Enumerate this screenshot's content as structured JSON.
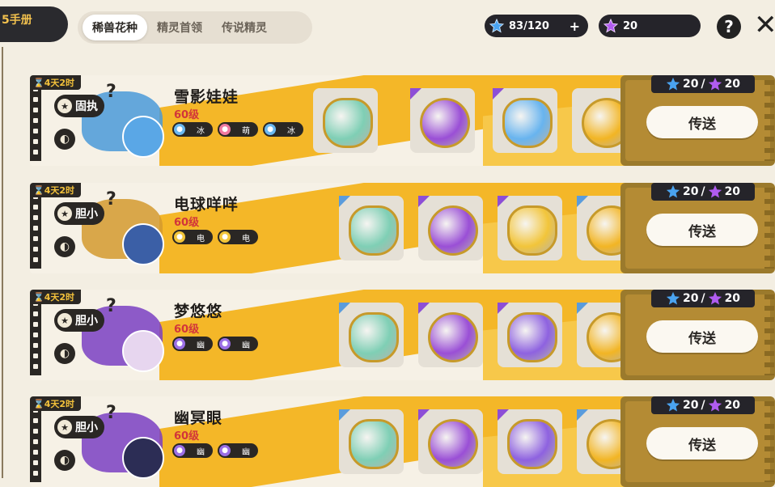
{
  "top_left_tab": {
    "label": "5手册"
  },
  "tabs": [
    {
      "label": "稀兽花种",
      "active": true
    },
    {
      "label": "精灵首领",
      "active": false
    },
    {
      "label": "传说精灵",
      "active": false
    }
  ],
  "currency": {
    "blue": {
      "value": "83/120",
      "icon": "blue-star-icon",
      "color": "#4aa3f0"
    },
    "purple": {
      "value": "20",
      "icon": "purple-star-icon",
      "color": "#b05cf0"
    }
  },
  "header_buttons": {
    "help": "?",
    "close": "✕"
  },
  "rows": [
    {
      "timer": "4天2时",
      "trait": "固执",
      "name": "雪影娃娃",
      "level": "60级",
      "types": [
        {
          "label": "冰",
          "icon": "ice-icon",
          "color": "#6ab8f0"
        },
        {
          "label": "萌",
          "icon": "cute-icon",
          "color": "#f07aa0"
        },
        {
          "label": "冰",
          "icon": "ice-icon",
          "color": "#6ab8f0"
        }
      ],
      "bag_color": "#4a9ad8",
      "char_color": "#5aa7e6",
      "items": [
        {
          "icon": "rainbow-potion-icon",
          "color": "#7fcfb5",
          "shape": "bottle",
          "corner": "none"
        },
        {
          "icon": "purple-orb-icon",
          "color": "#9a4fd6",
          "shape": "round",
          "corner": "purple"
        },
        {
          "icon": "ice-bottle-icon",
          "color": "#68b4ef",
          "shape": "bottle",
          "corner": "purple"
        },
        {
          "icon": "gold-coin-icon",
          "color": "#f2b524",
          "shape": "round",
          "corner": "none"
        }
      ],
      "cost": {
        "blue": "20",
        "sep": "/",
        "purple": "20"
      },
      "send": "传送"
    },
    {
      "timer": "4天2时",
      "trait": "胆小",
      "name": "电球咩咩",
      "level": "60级",
      "types": [
        {
          "label": "电",
          "icon": "electric-icon",
          "color": "#f2c53a"
        },
        {
          "label": "电",
          "icon": "electric-icon",
          "color": "#f2c53a"
        }
      ],
      "bag_color": "#d39a2e",
      "char_color": "#3b5fa6",
      "items": [
        {
          "icon": "rainbow-potion-icon",
          "color": "#7fcfb5",
          "shape": "bottle",
          "corner": "blue"
        },
        {
          "icon": "purple-orb-icon",
          "color": "#9a4fd6",
          "shape": "round",
          "corner": "purple"
        },
        {
          "icon": "electric-bottle-icon",
          "color": "#f2c53a",
          "shape": "bottle",
          "corner": "purple"
        },
        {
          "icon": "gold-coin-icon",
          "color": "#f2b524",
          "shape": "round",
          "corner": "blue"
        }
      ],
      "cost": {
        "blue": "20",
        "sep": "/",
        "purple": "20"
      },
      "send": "传送"
    },
    {
      "timer": "4天2时",
      "trait": "胆小",
      "name": "梦悠悠",
      "level": "60级",
      "types": [
        {
          "label": "幽",
          "icon": "ghost-icon",
          "color": "#9b6fe6"
        },
        {
          "label": "幽",
          "icon": "ghost-icon",
          "color": "#9b6fe6"
        }
      ],
      "bag_color": "#7a3fc2",
      "char_color": "#e7d6ef",
      "items": [
        {
          "icon": "rainbow-potion-icon",
          "color": "#7fcfb5",
          "shape": "bottle",
          "corner": "blue"
        },
        {
          "icon": "purple-orb-icon",
          "color": "#9a4fd6",
          "shape": "round",
          "corner": "purple"
        },
        {
          "icon": "ghost-bottle-icon",
          "color": "#8e62e0",
          "shape": "bottle",
          "corner": "purple"
        },
        {
          "icon": "gold-coin-icon",
          "color": "#f2b524",
          "shape": "round",
          "corner": "blue"
        }
      ],
      "cost": {
        "blue": "20",
        "sep": "/",
        "purple": "20"
      },
      "send": "传送"
    },
    {
      "timer": "4天2时",
      "trait": "胆小",
      "name": "幽冥眼",
      "level": "60级",
      "types": [
        {
          "label": "幽",
          "icon": "ghost-icon",
          "color": "#9b6fe6"
        },
        {
          "label": "幽",
          "icon": "ghost-icon",
          "color": "#9b6fe6"
        }
      ],
      "bag_color": "#7a3fc2",
      "char_color": "#2c2d55",
      "items": [
        {
          "icon": "rainbow-potion-icon",
          "color": "#7fcfb5",
          "shape": "bottle",
          "corner": "blue"
        },
        {
          "icon": "purple-orb-icon",
          "color": "#9a4fd6",
          "shape": "round",
          "corner": "purple"
        },
        {
          "icon": "ghost-bottle-icon",
          "color": "#8e62e0",
          "shape": "bottle",
          "corner": "purple"
        },
        {
          "icon": "gold-coin-icon",
          "color": "#f2b524",
          "shape": "round",
          "corner": "blue"
        }
      ],
      "cost": {
        "blue": "20",
        "sep": "/",
        "purple": "20"
      },
      "send": "传送"
    }
  ]
}
